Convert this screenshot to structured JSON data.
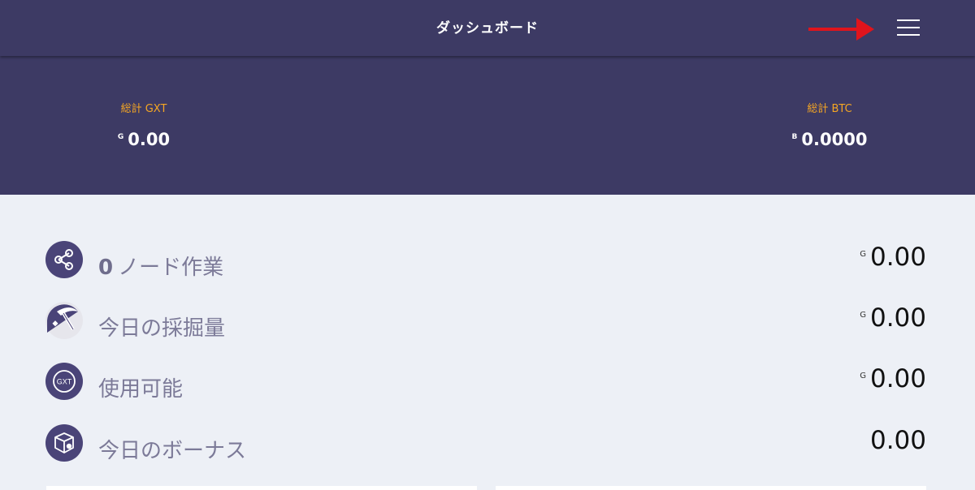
{
  "header": {
    "title": "ダッシュボード",
    "menu_icon": "hamburger-menu-icon",
    "annotation_color": "#e0141c"
  },
  "summary": {
    "gxt": {
      "label": "総計 GXT",
      "symbol": "G",
      "value": "0.00"
    },
    "btc": {
      "label": "総計 BTC",
      "symbol": "B",
      "value": "0.0000"
    }
  },
  "stats": [
    {
      "icon": "nodes-share-icon",
      "count": "0",
      "label": "ノード作業",
      "symbol": "G",
      "value": "0.00"
    },
    {
      "icon": "mining-pickaxe-icon",
      "label": "今日の採掘量",
      "symbol": "G",
      "value": "0.00"
    },
    {
      "icon": "gxt-coin-icon",
      "icon_text": "GXT",
      "label": "使用可能",
      "symbol": "G",
      "value": "0.00"
    },
    {
      "icon": "bonus-box-icon",
      "label": "今日のボーナス",
      "value": "0.00"
    }
  ],
  "colors": {
    "header_bg": "#3d3a64",
    "accent_label": "#f5a623",
    "content_bg": "#edf0f6",
    "icon_bg": "#4a4478"
  }
}
